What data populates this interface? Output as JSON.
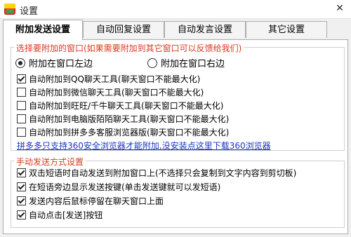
{
  "window": {
    "title": "设置",
    "close_symbol": "✕",
    "icon": "app-logo-icon"
  },
  "tabs": [
    {
      "label": "附加发送设置",
      "active": true
    },
    {
      "label": "自动回复设置",
      "active": false
    },
    {
      "label": "自动发言设置",
      "active": false
    },
    {
      "label": "其它设置",
      "active": false
    }
  ],
  "attach_group": {
    "label": "选择要附加的窗口(如果需要附加到其它窗口可以反馈给我们)",
    "radios": [
      {
        "label": "附加在窗口左边",
        "checked": true
      },
      {
        "label": "附加在窗口右边",
        "checked": false
      }
    ],
    "checkboxes": [
      {
        "label": "自动附加到QQ聊天工具(聊天窗口不能最大化)",
        "checked": true
      },
      {
        "label": "自动附加到微信聊天工具(聊天窗口不能最大化)",
        "checked": false
      },
      {
        "label": "自动附加到旺旺/千牛聊天工具(聊天窗口不能最大化)",
        "checked": false
      },
      {
        "label": "自动附加到电脑版陌陌聊天工具(聊天窗口不能最大化)",
        "checked": false
      },
      {
        "label": "自动附加到拼多多客服浏览器版(聊天窗口不能最大化)",
        "checked": false
      }
    ],
    "link": "拼多多只支持360安全浏览器才能附加,没安装点这里下载360浏览器"
  },
  "send_group": {
    "label": "手动发送方式设置",
    "checkboxes": [
      {
        "label": "双击短语时自动发送到附加窗口上(不选择只会复制到文字内容到剪切板)",
        "checked": true
      },
      {
        "label": "在短语旁边显示发送按键(单击发送键就可以发短语)",
        "checked": true
      },
      {
        "label": "发送内容后鼠标停留在聊天窗口上面",
        "checked": true
      },
      {
        "label": "自动点击[发送]按钮",
        "checked": true
      }
    ]
  },
  "colors": {
    "group_label": "#d83a1f",
    "link": "#1a35c4",
    "panel_bg": "#ffffff",
    "window_bg": "#f0f0f0"
  }
}
